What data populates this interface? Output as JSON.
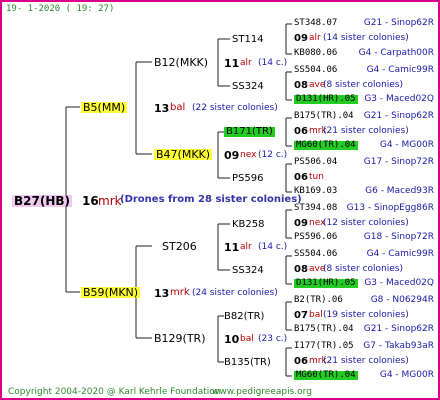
{
  "header": {
    "date": "19-  1-2020 ( 19: 27)"
  },
  "footer": {
    "copyright": "Copyright 2004-2020 @ Karl Kehrle Foundation",
    "site": "www.pedigreeapis.org"
  },
  "root": {
    "name": "B27(HB)",
    "num": "16",
    "race": "mrk",
    "note": "(Drones from 28 sister colonies)"
  },
  "gen1": [
    {
      "name": "B5(MM)",
      "num": "13",
      "race": "bal",
      "sisters": "(22 sister colonies)"
    },
    {
      "name": "B59(MKN)",
      "num": "13",
      "race": "mrk",
      "sisters": "(24 sister colonies)"
    }
  ],
  "gen2": [
    {
      "name": "B12(MKK)"
    },
    {
      "name": "B47(MKK)",
      "num": "09",
      "race": "nex",
      "sisters": "(12 c.)"
    },
    {
      "name": "ST206"
    },
    {
      "name": "B129(TR)",
      "num": "10",
      "race": "bal",
      "sisters": "(23 c.)"
    }
  ],
  "gen3": [
    {
      "name": "ST114",
      "num": "11",
      "race": "alr",
      "sisters": "(14 c.)"
    },
    {
      "name": "SS324"
    },
    {
      "name": "B171(TR)"
    },
    {
      "name": "PS596"
    },
    {
      "name": "KB258",
      "num": "11",
      "race": "alr",
      "sisters": "(14 c.)"
    },
    {
      "name": "SS324"
    },
    {
      "name": "B82(TR)"
    },
    {
      "name": "B135(TR)"
    }
  ],
  "gen4": [
    {
      "name": "ST348.07",
      "ref": "G21 - Sinop62R"
    },
    {
      "num": "09",
      "race": "alr",
      "sisters": "(14 sister colonies)"
    },
    {
      "name": "KB080.06",
      "ref": "G4 - Carpath00R"
    },
    {
      "name": "SS504.06",
      "ref": "G4 - Camic99R"
    },
    {
      "num": "08",
      "race": "ave",
      "sisters": "(8 sister colonies)"
    },
    {
      "name": "D131(HR).05",
      "ref": "G3 - Maced02Q"
    },
    {
      "name": "B175(TR).04",
      "ref": "G21 - Sinop62R"
    },
    {
      "num": "06",
      "race": "mrk",
      "sisters": "(21 sister colonies)"
    },
    {
      "name": "MG60(TR).04",
      "ref": "G4 - MG00R"
    },
    {
      "name": "PS506.04",
      "ref": "G17 - Sinop72R"
    },
    {
      "num": "06",
      "race": "tun",
      "sisters": ""
    },
    {
      "name": "KB169.03",
      "ref": "G6 - Maced93R"
    },
    {
      "name": "ST394.08",
      "ref": "G13 - SinopEgg86R"
    },
    {
      "num": "09",
      "race": "nex",
      "sisters": "(12 sister colonies)"
    },
    {
      "name": "PS596.06",
      "ref": "G18 - Sinop72R"
    },
    {
      "name": "SS504.06",
      "ref": "G4 - Camic99R"
    },
    {
      "num": "08",
      "race": "ave",
      "sisters": "(8 sister colonies)"
    },
    {
      "name": "D131(HR).05",
      "ref": "G3 - Maced02Q"
    },
    {
      "name": "B2(TR).06",
      "ref": "G8 - N06294R"
    },
    {
      "num": "07",
      "race": "bal",
      "sisters": "(19 sister colonies)"
    },
    {
      "name": "B175(TR).04",
      "ref": "G21 - Sinop62R"
    },
    {
      "name": "I177(TR).05",
      "ref": "G7 - Takab93aR"
    },
    {
      "num": "06",
      "race": "mrk",
      "sisters": "(21 sister colonies)"
    },
    {
      "name": "MG60(TR).04",
      "ref": "G4 - MG00R"
    }
  ],
  "colors": {
    "border": "#d9008c",
    "yellow": "#ffff33",
    "green": "#22cc22",
    "pink": "#f0c8f0",
    "link": "#1a1aa8"
  }
}
